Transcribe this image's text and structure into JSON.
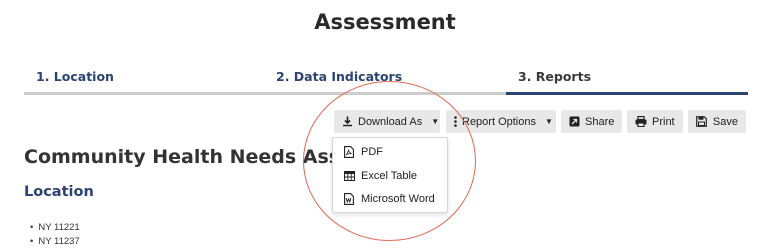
{
  "page_title": "Assessment",
  "steps": [
    {
      "label": "1. Location",
      "state": "done"
    },
    {
      "label": "2. Data Indicators",
      "state": "done"
    },
    {
      "label": "3. Reports",
      "state": "active"
    }
  ],
  "toolbar": {
    "download_label": "Download As",
    "report_options_label": "Report Options",
    "share_label": "Share",
    "print_label": "Print",
    "save_label": "Save"
  },
  "download_menu": {
    "items": [
      {
        "label": "PDF",
        "icon": "pdf-file-icon"
      },
      {
        "label": "Excel Table",
        "icon": "table-icon"
      },
      {
        "label": "Microsoft Word",
        "icon": "word-file-icon"
      }
    ]
  },
  "report": {
    "title": "Community Health Needs Ass",
    "location_heading": "Location",
    "locations": [
      "NY 11221",
      "NY 11237"
    ]
  },
  "colors": {
    "primary": "#2b4470",
    "button_bg": "#e8e8e8",
    "highlight": "#e06a52",
    "track": "#cccccc"
  }
}
